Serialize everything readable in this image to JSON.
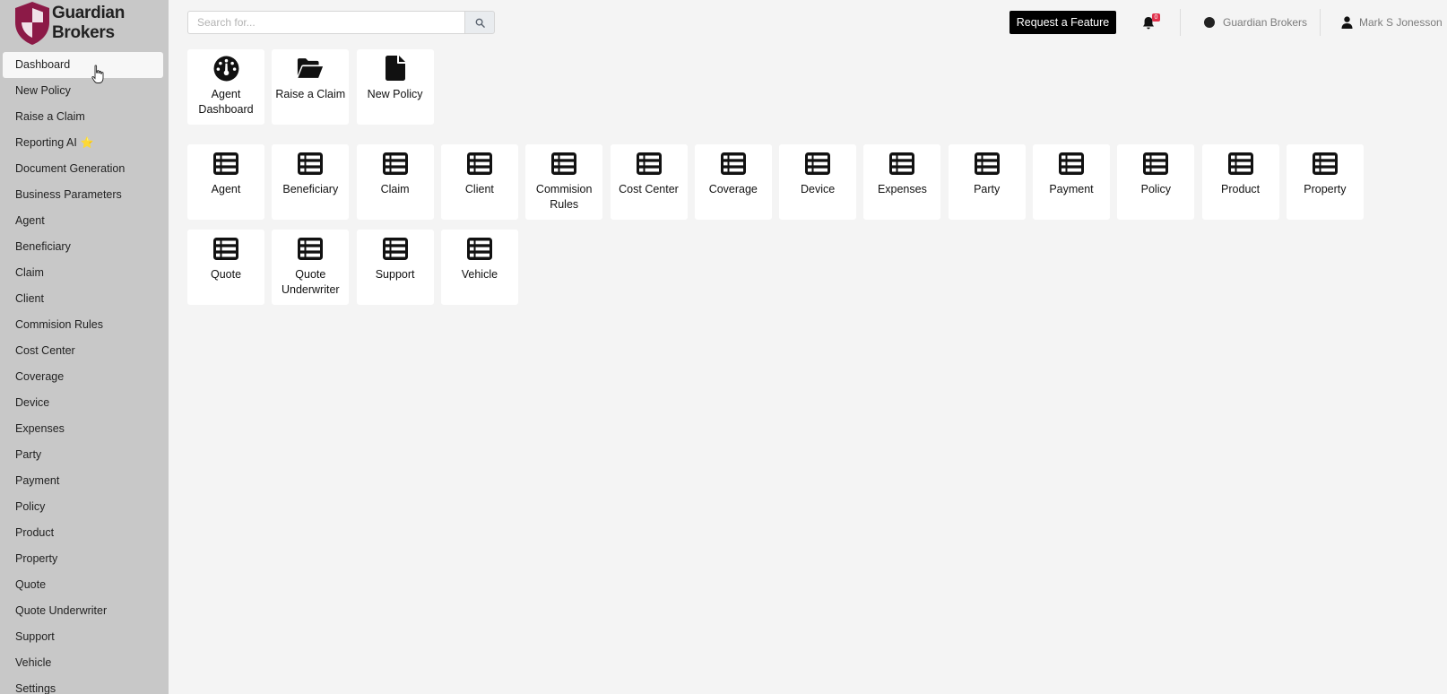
{
  "brand": {
    "name": "Guardian\nBrokers",
    "logo_colors": [
      "#8c1a47",
      "#f0e1e8"
    ]
  },
  "sidebar": {
    "items": [
      {
        "label": "Dashboard",
        "active": true
      },
      {
        "label": "New Policy"
      },
      {
        "label": "Raise a Claim"
      },
      {
        "label": "Reporting AI",
        "badge_icon": "star-icon"
      },
      {
        "label": "Document Generation"
      },
      {
        "label": "Business Parameters"
      },
      {
        "label": "Agent"
      },
      {
        "label": "Beneficiary"
      },
      {
        "label": "Claim"
      },
      {
        "label": "Client"
      },
      {
        "label": "Commision Rules"
      },
      {
        "label": "Cost Center"
      },
      {
        "label": "Coverage"
      },
      {
        "label": "Device"
      },
      {
        "label": "Expenses"
      },
      {
        "label": "Party"
      },
      {
        "label": "Payment"
      },
      {
        "label": "Policy"
      },
      {
        "label": "Product"
      },
      {
        "label": "Property"
      },
      {
        "label": "Quote"
      },
      {
        "label": "Quote Underwriter"
      },
      {
        "label": "Support"
      },
      {
        "label": "Vehicle"
      },
      {
        "label": "Settings"
      }
    ]
  },
  "search": {
    "placeholder": "Search for...",
    "value": ""
  },
  "header": {
    "feature_button": "Request a Feature",
    "notification_count": "0",
    "company": "Guardian Brokers",
    "user": "Mark S Jonesson"
  },
  "quick_actions": [
    {
      "label": "Agent Dashboard",
      "icon": "dashboard-gauge-icon"
    },
    {
      "label": "Raise a Claim",
      "icon": "folder-open-icon"
    },
    {
      "label": "New Policy",
      "icon": "document-icon"
    }
  ],
  "entities": [
    {
      "label": "Agent",
      "icon": "table-list-icon"
    },
    {
      "label": "Beneficiary",
      "icon": "table-list-icon"
    },
    {
      "label": "Claim",
      "icon": "table-list-icon"
    },
    {
      "label": "Client",
      "icon": "table-list-icon"
    },
    {
      "label": "Commision Rules",
      "icon": "table-list-icon"
    },
    {
      "label": "Cost Center",
      "icon": "table-list-icon"
    },
    {
      "label": "Coverage",
      "icon": "table-list-icon"
    },
    {
      "label": "Device",
      "icon": "table-list-icon"
    },
    {
      "label": "Expenses",
      "icon": "table-list-icon"
    },
    {
      "label": "Party",
      "icon": "table-list-icon"
    },
    {
      "label": "Payment",
      "icon": "table-list-icon"
    },
    {
      "label": "Policy",
      "icon": "table-list-icon"
    },
    {
      "label": "Product",
      "icon": "table-list-icon"
    },
    {
      "label": "Property",
      "icon": "table-list-icon"
    },
    {
      "label": "Quote",
      "icon": "table-list-icon"
    },
    {
      "label": "Quote Underwriter",
      "icon": "table-list-icon"
    },
    {
      "label": "Support",
      "icon": "table-list-icon"
    },
    {
      "label": "Vehicle",
      "icon": "table-list-icon"
    }
  ]
}
